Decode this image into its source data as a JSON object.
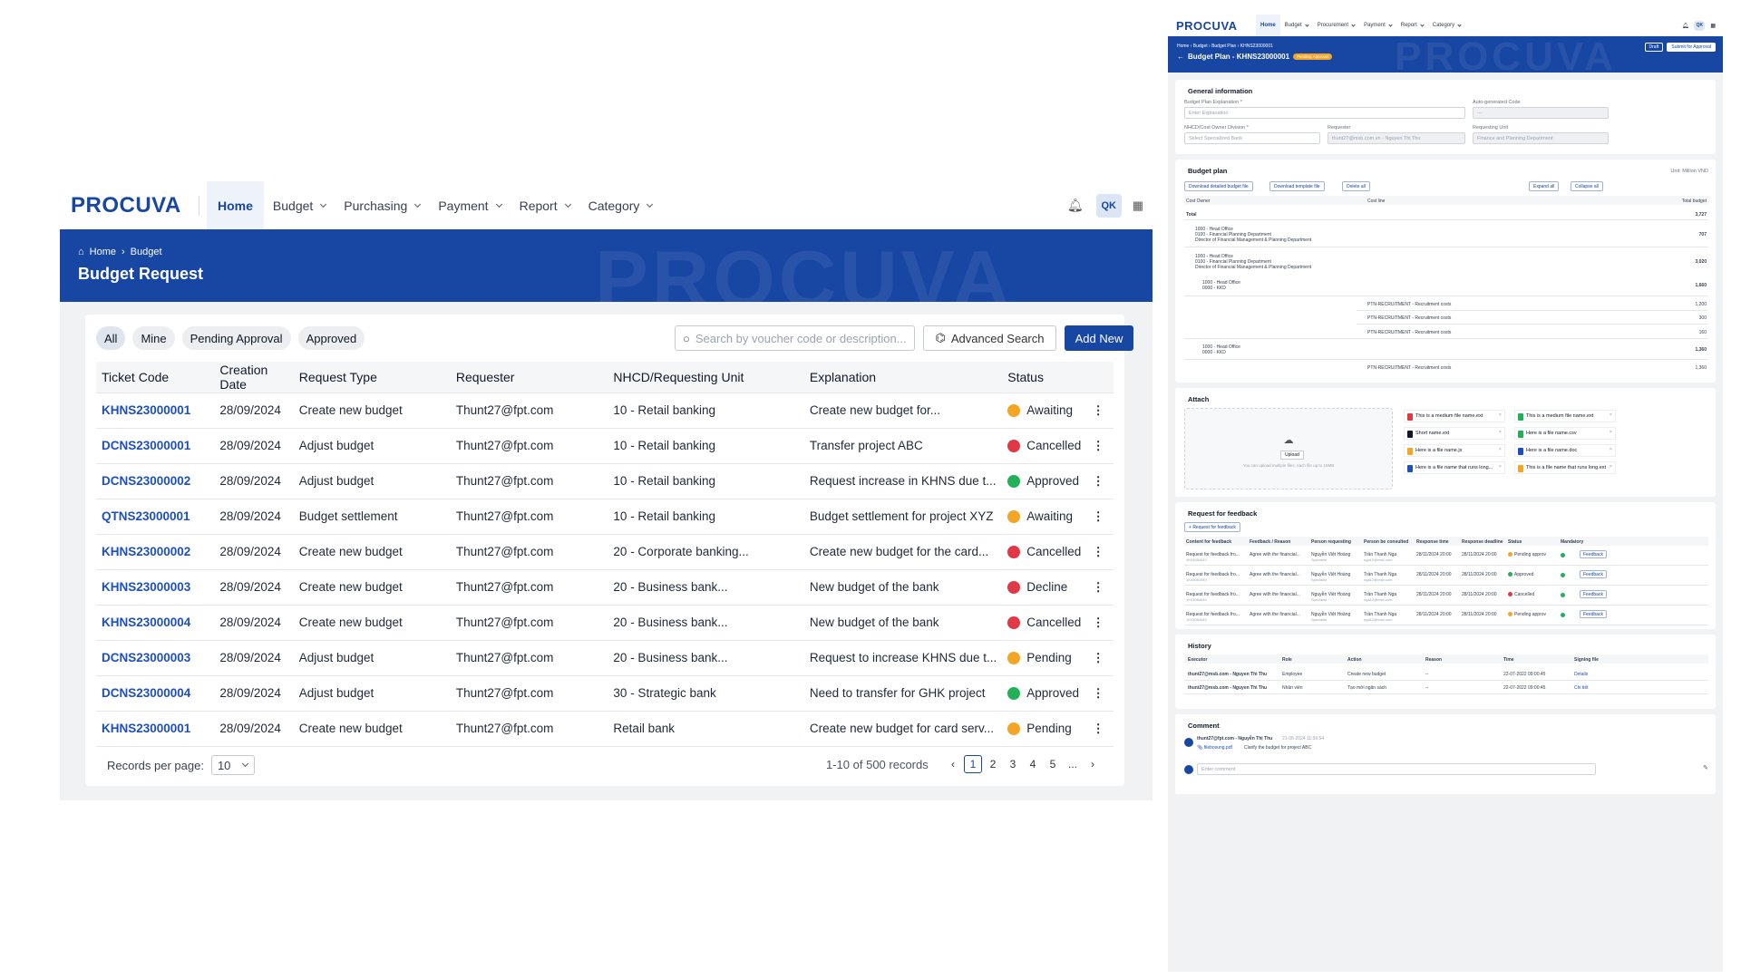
{
  "list": {
    "logo": "PROCUVA",
    "nav": [
      "Home",
      "Budget",
      "Purchasing",
      "Payment",
      "Report",
      "Category"
    ],
    "user_initials": "QK",
    "breadcrumb": [
      "Home",
      "Budget"
    ],
    "title": "Budget Request",
    "filters": [
      "All",
      "Mine",
      "Pending Approval",
      "Approved"
    ],
    "search_placeholder": "Search by voucher code or description...",
    "advanced_search": "Advanced Search",
    "add_new": "Add New",
    "columns": [
      "Ticket Code",
      "Creation Date",
      "Request Type",
      "Requester",
      "NHCD/Requesting Unit",
      "Explanation",
      "Status"
    ],
    "rows": [
      [
        "KHNS23000001",
        "28/09/2024",
        "Create new budget",
        "Thunt27@fpt.com",
        "10 - Retail banking",
        "Create new budget for...",
        "Awaiting",
        "#f5a524"
      ],
      [
        "DCNS23000001",
        "28/09/2024",
        "Adjust budget",
        "Thunt27@fpt.com",
        "10 - Retail banking",
        "Transfer project ABC",
        "Cancelled",
        "#e23744"
      ],
      [
        "DCNS23000002",
        "28/09/2024",
        "Adjust budget",
        "Thunt27@fpt.com",
        "10 - Retail banking",
        "Request increase in KHNS due t...",
        "Approved",
        "#22b058"
      ],
      [
        "QTNS23000001",
        "28/09/2024",
        "Budget settlement",
        "Thunt27@fpt.com",
        "10 - Retail banking",
        "Budget settlement for project XYZ",
        "Awaiting",
        "#f5a524"
      ],
      [
        "KHNS23000002",
        "28/09/2024",
        "Create new budget",
        "Thunt27@fpt.com",
        "20 - Corporate banking...",
        "Create new budget for the card...",
        "Cancelled",
        "#e23744"
      ],
      [
        "KHNS23000003",
        "28/09/2024",
        "Create new budget",
        "Thunt27@fpt.com",
        "20 - Business bank...",
        "New budget of the bank",
        "Decline",
        "#e23744"
      ],
      [
        "KHNS23000004",
        "28/09/2024",
        "Create new budget",
        "Thunt27@fpt.com",
        "20 - Business bank...",
        "New budget of the bank",
        "Cancelled",
        "#e23744"
      ],
      [
        "DCNS23000003",
        "28/09/2024",
        "Adjust budget",
        "Thunt27@fpt.com",
        "20 - Business bank...",
        "Request to increase KHNS due t...",
        "Pending",
        "#f5a524"
      ],
      [
        "DCNS23000004",
        "28/09/2024",
        "Adjust budget",
        "Thunt27@fpt.com",
        "30 - Strategic bank",
        "Need to transfer for GHK project",
        "Approved",
        "#22b058"
      ],
      [
        "KHNS23000001",
        "28/09/2024",
        "Create new budget",
        "Thunt27@fpt.com",
        "Retail bank",
        "Create new budget for card serv...",
        "Pending",
        "#f5a524"
      ]
    ],
    "records_label": "Records per page:",
    "records_value": "10",
    "range": "1-10 of 500 records",
    "pages": [
      "1",
      "2",
      "3",
      "4",
      "5",
      "..."
    ]
  },
  "detail": {
    "logo": "PROCUVA",
    "nav": [
      "Home",
      "Budget",
      "Procurement",
      "Payment",
      "Report",
      "Category"
    ],
    "user_initials": "QK",
    "breadcrumb": "Home › Budget › Budget Plan › KHNS23000001",
    "title": "Budget Plan - KHNS23000001",
    "badge": "Pending Approval",
    "draft": "Draft",
    "submit": "Submit for Approval",
    "general": {
      "title": "General information",
      "f1": "Budget Plan Explanation *",
      "p1": "Enter Explanation",
      "f2": "Auto-generated Code",
      "p2": "---",
      "f3": "NHCD/Cost Owner Division *",
      "p3": "Select Specialized Bank",
      "f4": "Requester",
      "p4": "thunt27@msb.com.vn - Nguyen Thi Thu",
      "f5": "Requesting Unit",
      "p5": "Finance and Planning Department"
    },
    "plan": {
      "title": "Budget plan",
      "unit": "Unit: Million VND",
      "b1": "Download detailed budget file",
      "b2": "Download template file",
      "b3": "Delete all",
      "b4": "Expand all",
      "b5": "Collapse all",
      "h1": "Cost Owner",
      "h2": "Cost line",
      "h3": "Total budget",
      "total_label": "Total",
      "total": "3,727",
      "g1": [
        "1000 - Head Office",
        "0100 - Financial Planning Department",
        "Director of Financial Management & Planning Department",
        "707"
      ],
      "g2": [
        "1000 - Head Office",
        "0100 - Financial Planning Department",
        "Director of Financial Management & Planning Department",
        "3,020"
      ],
      "s1": [
        "1000 - Head Office",
        "0000 - KKD",
        "1,660"
      ],
      "l1": [
        "PTN-RECRUITMENT - Recruitment costs",
        "1,200"
      ],
      "l2": [
        "PTN-RECRUITMENT - Recruitment costs",
        "300"
      ],
      "l3": [
        "PTN-RECRUITMENT - Recruitment costs",
        "160"
      ],
      "s2": [
        "1000 - Head Office",
        "0000 - KKD",
        "1,360"
      ],
      "l4": [
        "PTN-RECRUITMENT - Recruitment costs",
        "1,360"
      ]
    },
    "attach": {
      "title": "Attach",
      "upload": "Upload",
      "hint": "You can upload multiple files, each file up to 15MB",
      "files": [
        "This is a medium file name.ext",
        "This is a medium file name.ext",
        "Short name.ext",
        "Here is a file name.csv",
        "Here is a file name.js",
        "Here is a file name.doc",
        "Here is a file name that runs long...",
        "This is a file name that runs long.ext"
      ]
    },
    "feedback": {
      "title": "Request for feedback",
      "btn": "Request for feedback",
      "cols": [
        "Content for feedback",
        "Feedback / Reason",
        "Person requesting",
        "Person be consulted",
        "Response time",
        "Response deadline",
        "Status",
        "Mandatory"
      ],
      "rows": [
        [
          "Request for feedback fro...",
          "Agree with the financial...",
          "Nguyễn Việt Hoàng",
          "Trần Thanh Nga",
          "28/11/2024 20:00",
          "28/11/2024 20:00",
          "Pending approv",
          "#f5a524"
        ],
        [
          "Request for feedback fro...",
          "Agree with the financial...",
          "Nguyễn Việt Hoàng",
          "Trần Thanh Nga",
          "28/11/2024 20:00",
          "28/11/2024 20:00",
          "Approved",
          "#22b058"
        ],
        [
          "Request for feedback fro...",
          "Agree with the financial...",
          "Nguyễn Việt Hoàng",
          "Trần Thanh Nga",
          "28/11/2024 20:00",
          "28/11/2024 20:00",
          "Cancelled",
          "#e23744"
        ],
        [
          "Request for feedback fro...",
          "Agree with the financial...",
          "Nguyễn Việt Hoàng",
          "Trần Thanh Nga",
          "28/11/2024 20:00",
          "28/11/2024 20:00",
          "Pending approv",
          "#f5a524"
        ]
      ],
      "sub": [
        "1K03084049",
        "Specialist",
        "nga12@msb.com"
      ],
      "action": "Feedback"
    },
    "history": {
      "title": "History",
      "cols": [
        "Executor",
        "Role",
        "Action",
        "Reason",
        "Time",
        "Signing file"
      ],
      "rows": [
        [
          "thunt27@msb.com - Nguyen Thi Thu",
          "Employee",
          "Create new budget",
          "--",
          "22-07-2022 09:00:45",
          "Details"
        ],
        [
          "thunt27@msb.com - Nguyen Thi Thu",
          "Nhân viên",
          "Tạo mới ngân sách",
          "--",
          "22-07-2022 09:00:45",
          "Chi tiết"
        ]
      ]
    },
    "comment": {
      "title": "Comment",
      "author": "thunt27@fpt.com - Nguyễn Thị Thu",
      "time": "21-06-2024 11:56:54",
      "file": "filebosung.pdf",
      "text": "Clarify the budget for project ABC",
      "placeholder": "Enter comment"
    }
  }
}
